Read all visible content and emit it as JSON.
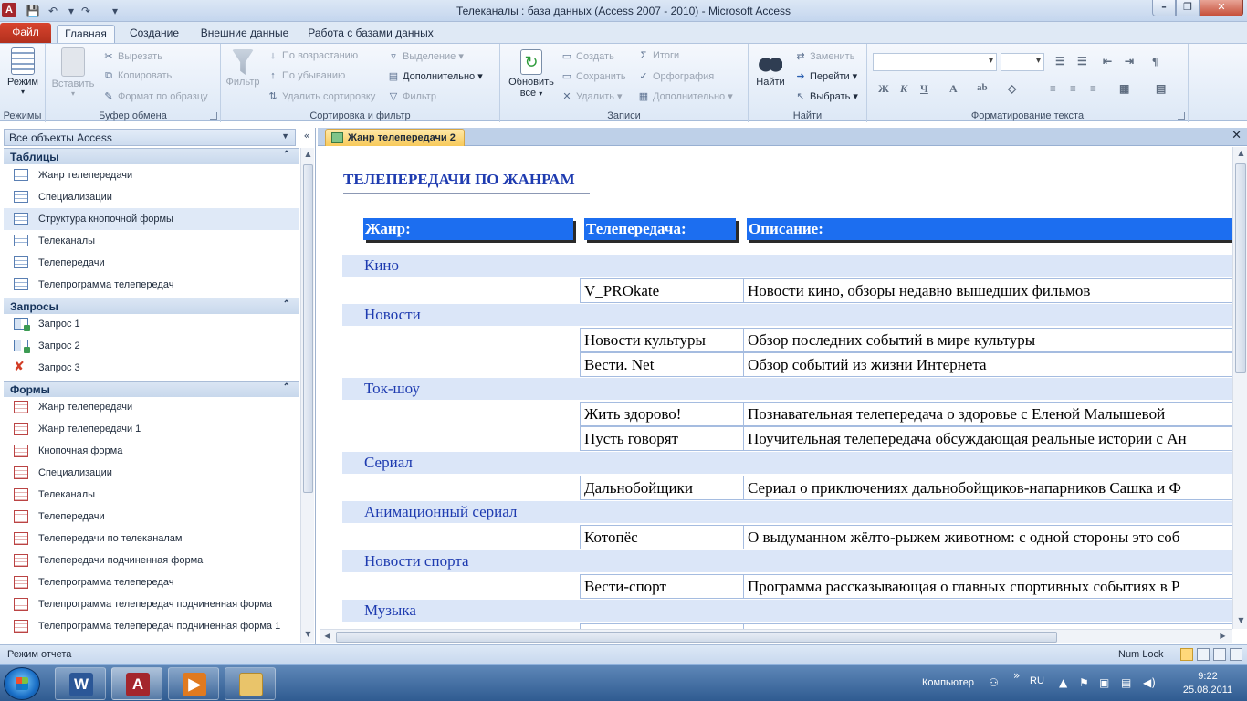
{
  "window": {
    "title": "Телеканалы : база данных (Access 2007 - 2010)  -  Microsoft Access",
    "app_icon_letter": "A"
  },
  "ribbon_tabs": [
    {
      "label": "Файл",
      "active": false
    },
    {
      "label": "Главная",
      "active": true
    },
    {
      "label": "Создание",
      "active": false
    },
    {
      "label": "Внешние данные",
      "active": false
    },
    {
      "label": "Работа с базами данных",
      "active": false
    }
  ],
  "ribbon": {
    "groups": {
      "views": "Режимы",
      "clipboard": "Буфер обмена",
      "sort_filter": "Сортировка и фильтр",
      "records": "Записи",
      "find": "Найти",
      "text_format": "Форматирование текста"
    },
    "view_button": "Режим",
    "paste_button": "Вставить",
    "cut": "Вырезать",
    "copy": "Копировать",
    "format_painter": "Формат по образцу",
    "filter_button": "Фильтр",
    "ascending": "По возрастанию",
    "descending": "По убыванию",
    "remove_sort": "Удалить сортировку",
    "selection": "Выделение",
    "advanced": "Дополнительно",
    "toggle_filter": "Фильтр",
    "refresh_line1": "Обновить",
    "refresh_line2": "все",
    "new_record": "Создать",
    "save_record": "Сохранить",
    "delete_record": "Удалить",
    "totals": "Итоги",
    "spelling": "Орфография",
    "more_records": "Дополнительно",
    "find_button": "Найти",
    "replace": "Заменить",
    "goto": "Перейти",
    "select": "Выбрать",
    "bold": "Ж",
    "italic": "К",
    "underline": "Ч"
  },
  "nav_pane": {
    "header": "Все объекты Access",
    "sections": [
      {
        "title": "Таблицы",
        "kind": "table",
        "items": [
          "Жанр телепередачи",
          "Специализации",
          "Структура кнопочной формы",
          "Телеканалы",
          "Телепередачи",
          "Телепрограмма телепередач"
        ],
        "selected": "Структура кнопочной формы"
      },
      {
        "title": "Запросы",
        "kind": "query",
        "items": [
          "Запрос 1",
          "Запрос 2",
          "Запрос 3"
        ]
      },
      {
        "title": "Формы",
        "kind": "form",
        "items": [
          "Жанр телепередачи",
          "Жанр телепередачи 1",
          "Кнопочная форма",
          "Специализации",
          "Телеканалы",
          "Телепередачи",
          "Телепередачи по телеканалам",
          "Телепередачи подчиненная форма",
          "Телепрограмма телепередач",
          "Телепрограмма телепередач подчиненная форма",
          "Телепрограмма телепередач подчиненная форма 1"
        ]
      }
    ]
  },
  "document": {
    "tab_label": "Жанр телепередачи 2",
    "report_title": "ТЕЛЕПЕРЕДАЧИ ПО ЖАНРАМ",
    "columns": [
      "Жанр:",
      "Телепередача:",
      "Описание:"
    ],
    "groups": [
      {
        "genre": "Кино",
        "rows": [
          [
            "V_PROkate",
            "Новости кино, обзоры недавно вышедших фильмов"
          ]
        ]
      },
      {
        "genre": "Новости",
        "rows": [
          [
            "Новости культуры",
            "Обзор последних событий в мире культуры"
          ],
          [
            "Вести. Net",
            "Обзор событий из жизни Интернета"
          ]
        ]
      },
      {
        "genre": "Ток-шоу",
        "rows": [
          [
            "Жить здорово!",
            "Познавательная телепередача о здоровье с Еленой Малышевой"
          ],
          [
            "Пусть говорят",
            "Поучительная телепередача обсуждающая реальные истории с Ан"
          ]
        ]
      },
      {
        "genre": "Сериал",
        "rows": [
          [
            "Дальнобойщики",
            "Сериал о приключениях дальнобойщиков-напарников Сашка и Ф"
          ]
        ]
      },
      {
        "genre": "Анимационный сериал",
        "rows": [
          [
            "Котопёс",
            "О выдуманном жёлто-рыжем животном: с одной стороны это соб"
          ]
        ]
      },
      {
        "genre": "Новости спорта",
        "rows": [
          [
            "Вести-спорт",
            "Программа рассказывающая о главных спортивных событиях в Р"
          ]
        ]
      },
      {
        "genre": "Музыка",
        "rows": []
      }
    ]
  },
  "status_bar": {
    "left": "Режим отчета",
    "numlock": "Num Lock"
  },
  "taskbar": {
    "apps": [
      {
        "name": "word",
        "letter": "W",
        "color": "#2b5797"
      },
      {
        "name": "access",
        "letter": "A",
        "color": "#a4262c"
      },
      {
        "name": "media-player",
        "letter": "▶",
        "color": "#e07a1f"
      },
      {
        "name": "explorer",
        "letter": "",
        "color": "#e9c46a"
      }
    ],
    "computer_label": "Компьютер",
    "lang": "RU",
    "time": "9:22",
    "date": "25.08.2011"
  },
  "colors": {
    "header_fill": "#1c6ef0",
    "group_row_fill": "#dbe6f8",
    "genre_text": "#1e3bb0",
    "file_tab": "#c23a25"
  }
}
